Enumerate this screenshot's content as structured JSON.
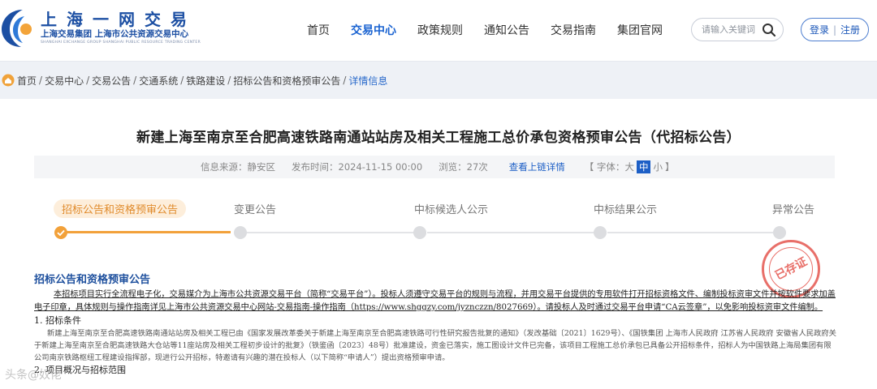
{
  "logo": {
    "title": "上海一网交易",
    "subtitle": "上海交易集团 上海市公共资源交易中心",
    "english": "SHANGHAI EXCHANGE GROUP   SHANGHAI PUBLIC RESOURCE TRADING CENTER"
  },
  "nav": {
    "items": [
      "首页",
      "交易中心",
      "政策规则",
      "通知公告",
      "交易指南",
      "集团官网"
    ],
    "active_index": 1
  },
  "search": {
    "placeholder": "请输入关键词"
  },
  "auth": {
    "login": "登录",
    "sep": "|",
    "register": "注册"
  },
  "breadcrumb": {
    "items": [
      "首页",
      "交易中心",
      "交易公告",
      "交通系统",
      "铁路建设",
      "招标公告和资格预审公告",
      "详情信息"
    ],
    "separator": "/"
  },
  "article": {
    "title": "新建上海至南京至合肥高速铁路南通站站房及相关工程施工总价承包资格预审公告（代招标公告）",
    "source_label": "信息来源：",
    "source": "静安区",
    "time_label": "发布时间：",
    "time": "2024-11-15 00:00",
    "views_label": "浏览：",
    "views": "27次",
    "chain_link": "查看上链详情",
    "font_label": "【 字体：",
    "font_large": "大",
    "font_medium": "中",
    "font_small": "小",
    "font_end": "】"
  },
  "steps": [
    {
      "label": "招标公告和资格预审公告",
      "active": true
    },
    {
      "label": "变更公告",
      "active": false
    },
    {
      "label": "中标候选人公示",
      "active": false
    },
    {
      "label": "中标结果公示",
      "active": false
    },
    {
      "label": "异常公告",
      "active": false
    }
  ],
  "stamp": {
    "text": "已存证"
  },
  "section": {
    "title": "招标公告和资格预审公告",
    "intro": "本招标项目实行全流程电子化，交易媒介为上海市公共资源交易平台（简称“交易平台”）。投标人须遵守交易平台的规则与流程，并用交易平台提供的专用软件打开招标资格文件、编制投标资审文件并按软件要求加盖电子印章，具体规则与操作指南详见上海市公共资源交易中心网站-交易指南-操作指南（https://www.shggzy.com/jyznczzn/8027669）。请投标人及时通过交易平台申请“CA云签章”，以免影响投标资审文件编制。",
    "heading1": "1. 招标条件",
    "para1": "新建上海至南京至合肥高速铁路南通站站房及相关工程已由《国家发展改革委关于新建上海至南京至合肥高速铁路可行性研究报告批复的通知》（发改基础〔2021〕1629号）、《国铁集团 上海市人民政府 江苏省人民政府 安徽省人民政府关于新建上海至南京至合肥高速铁路大仓站等11座站房及相关工程初步设计的批复》（铁鉴函〔2023〕48号）批准建设，资金已落实，施工图设计文件已完备，该项目工程施工总价承包已具备公开招标条件，招标人为中国铁路上海局集团有限公司南京铁路枢纽工程建设指挥部，现进行公开招标，特邀请有兴趣的潜在投标人（以下简称“申请人”）提出资格预审申请。",
    "heading2": "2. 项目概况与招标范围"
  },
  "watermark": "头条@奴佬"
}
